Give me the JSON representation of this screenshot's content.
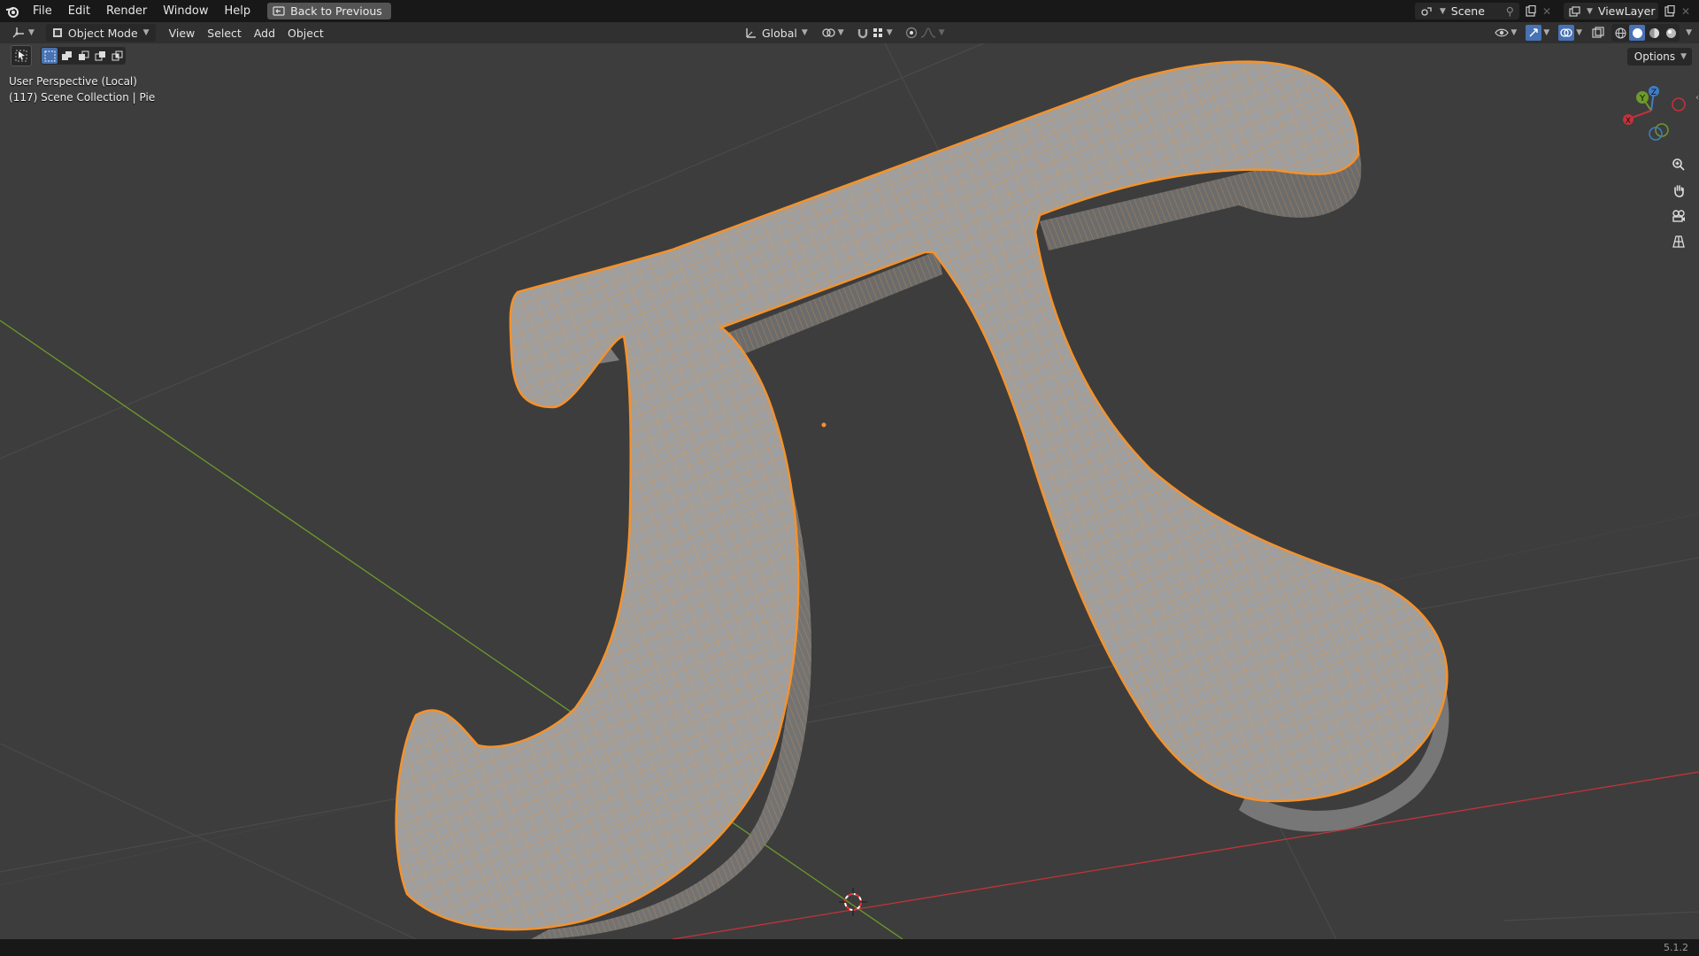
{
  "topbar": {
    "menus": [
      "File",
      "Edit",
      "Render",
      "Window",
      "Help"
    ],
    "back_label": "Back to Previous",
    "scene_name": "Scene",
    "view_layer": "ViewLayer"
  },
  "header": {
    "mode": "Object Mode",
    "menus": [
      "View",
      "Select",
      "Add",
      "Object"
    ],
    "transform_orientation": "Global"
  },
  "viewport": {
    "perspective_label": "User Perspective (Local)",
    "collection_label": "(117) Scene Collection | Pie",
    "options_label": "Options",
    "gizmo_axes": [
      "X",
      "Y",
      "Z"
    ]
  },
  "status": {
    "version": "5.1.2"
  },
  "colors": {
    "selection": "#f5922b",
    "x_axis": "#c2333b",
    "y_axis": "#6d9a2a",
    "active_tool": "#4772b3"
  }
}
